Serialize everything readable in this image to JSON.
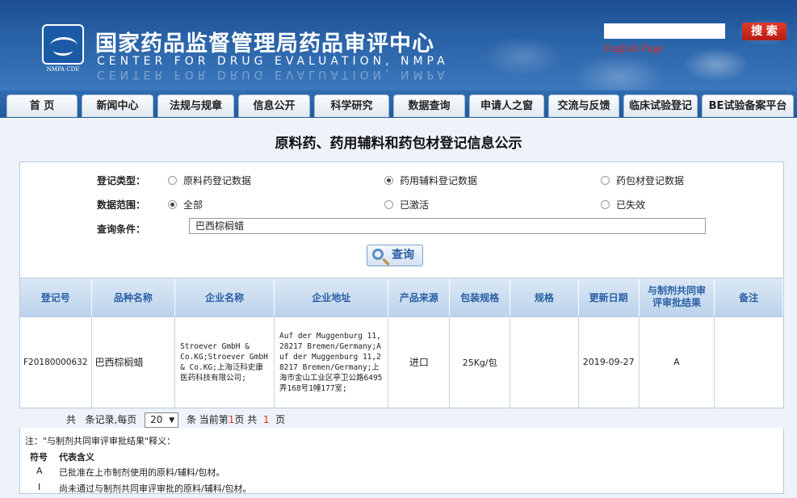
{
  "header": {
    "logo_caption": "NMPA CDE",
    "title_cn": "国家药品监督管理局药品审评中心",
    "title_en": "CENTER FOR DRUG EVALUATION, NMPA",
    "search_value": "",
    "search_button": "搜 索",
    "english_link": "English Page"
  },
  "nav": [
    "首 页",
    "新闻中心",
    "法规与规章",
    "信息公开",
    "科学研究",
    "数据查询",
    "申请人之窗",
    "交流与反馈",
    "临床试验登记",
    "BE试验备案平台"
  ],
  "page_title": "原料药、药用辅料和药包材登记信息公示",
  "form": {
    "type_label": "登记类型：",
    "type_options": [
      {
        "label": "原料药登记数据",
        "checked": false
      },
      {
        "label": "药用辅料登记数据",
        "checked": true
      },
      {
        "label": "药包材登记数据",
        "checked": false
      }
    ],
    "scope_label": "数据范围：",
    "scope_options": [
      {
        "label": "全部",
        "checked": true
      },
      {
        "label": "已激活",
        "checked": false
      },
      {
        "label": "已失效",
        "checked": false
      }
    ],
    "query_label": "查询条件：",
    "query_value": "巴西棕榈蜡",
    "query_button": "查询"
  },
  "table": {
    "headers": [
      "登记号",
      "品种名称",
      "企业名称",
      "企业地址",
      "产品来源",
      "包装规格",
      "规格",
      "更新日期",
      "与制剂共同审评审批结果",
      "备注"
    ],
    "rows": [
      {
        "reg_no": "F20180000632",
        "name": "巴西棕榈蜡",
        "company": "Stroever GmbH & Co.KG;Stroever GmbH & Co.KG;上海泛科史康医药科技有限公司;",
        "address": "Auf der Muggenburg 11,28217 Bremen/Germany;Auf der Muggenburg 11,28217 Bremen/Germany;上海市金山工业区亭卫公路6495弄168号1幢177室;",
        "source": "进口",
        "package": "25Kg/包",
        "spec": "",
        "updated": "2019-09-27",
        "result": "A",
        "remark": ""
      }
    ]
  },
  "pager": {
    "prefix": "共",
    "mid1": "条记录,每页",
    "per_page": "20",
    "mid2": "条 当前第",
    "current": "1",
    "mid3": "页 共",
    "total": "1",
    "suffix": "页"
  },
  "notes": {
    "title": "注：\"与制剂共同审评审批结果\"释义：",
    "col_symbol": "符号",
    "col_meaning": "代表含义",
    "items": [
      {
        "symbol": "A",
        "meaning": "已批准在上市制剂使用的原料/辅料/包材。"
      },
      {
        "symbol": "I",
        "meaning": "尚未通过与制剂共同审评审批的原料/辅料/包材。"
      }
    ]
  },
  "colors": {
    "header_blue": "#2a63a8",
    "nav_blue": "#225a9d",
    "accent_red": "#e02a22",
    "table_header_text": "#2a5fa4"
  }
}
